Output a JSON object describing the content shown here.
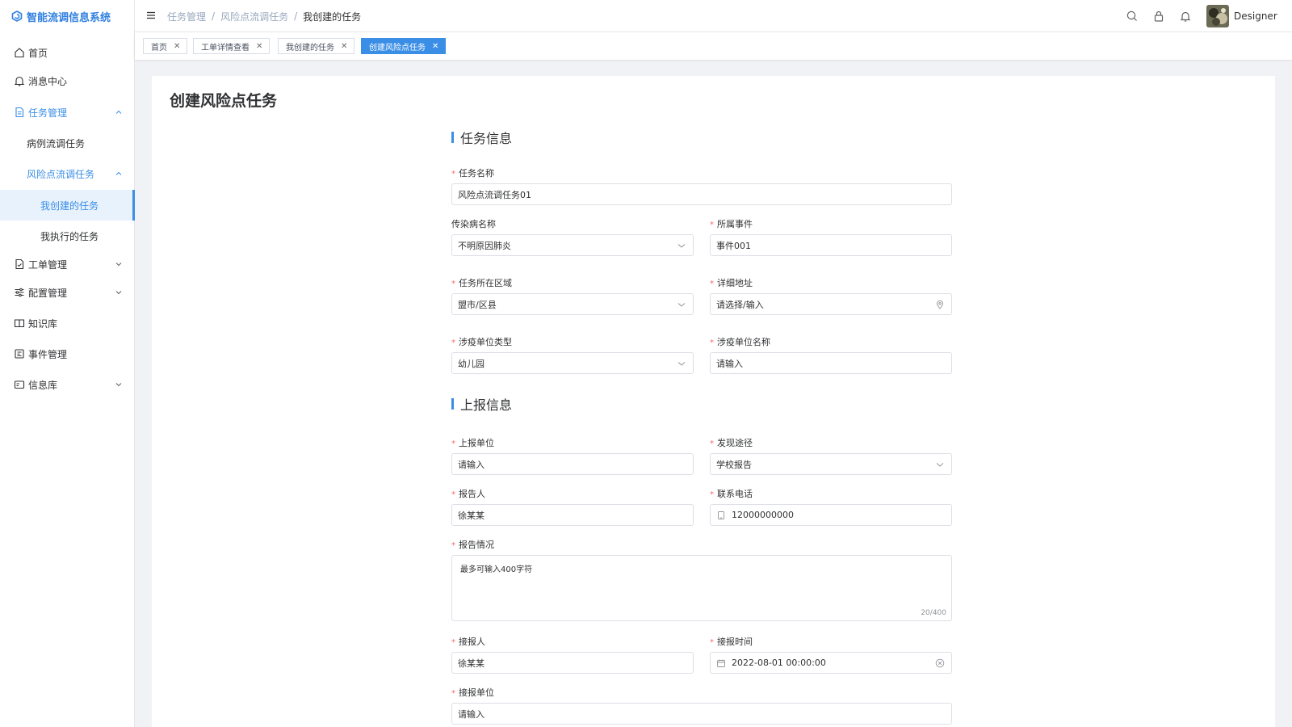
{
  "app": {
    "title": "智能流调信息系统"
  },
  "sidebar": {
    "items": [
      {
        "label": "首页"
      },
      {
        "label": "消息中心"
      },
      {
        "label": "任务管理"
      },
      {
        "label": "病例流调任务"
      },
      {
        "label": "风险点流调任务"
      },
      {
        "label": "我创建的任务"
      },
      {
        "label": "我执行的任务"
      },
      {
        "label": "工单管理"
      },
      {
        "label": "配置管理"
      },
      {
        "label": "知识库"
      },
      {
        "label": "事件管理"
      },
      {
        "label": "信息库"
      }
    ]
  },
  "breadcrumb": {
    "items": [
      "任务管理",
      "风险点流调任务",
      "我创建的任务"
    ]
  },
  "user": {
    "name": "Designer"
  },
  "tags": [
    {
      "label": "首页"
    },
    {
      "label": "工单详情查看"
    },
    {
      "label": "我创建的任务"
    },
    {
      "label": "创建风险点任务"
    }
  ],
  "page": {
    "title": "创建风险点任务"
  },
  "task_section": {
    "title": "任务信息",
    "task_name": {
      "label": "任务名称",
      "value": "风险点流调任务01"
    },
    "disease": {
      "label": "传染病名称",
      "value": "不明原因肺炎"
    },
    "event": {
      "label": "所属事件",
      "value": "事件001"
    },
    "region": {
      "label": "任务所在区域",
      "value": "盟市/区县"
    },
    "address": {
      "label": "详细地址",
      "placeholder": "请选择/输入"
    },
    "unit_type": {
      "label": "涉疫单位类型",
      "value": "幼儿园"
    },
    "unit_name": {
      "label": "涉疫单位名称",
      "placeholder": "请输入"
    }
  },
  "report_section": {
    "title": "上报信息",
    "report_unit": {
      "label": "上报单位",
      "placeholder": "请输入"
    },
    "discovery": {
      "label": "发现途径",
      "value": "学校报告"
    },
    "reporter": {
      "label": "报告人",
      "value": "徐某某"
    },
    "phone": {
      "label": "联系电话",
      "value": "12000000000"
    },
    "situation": {
      "label": "报告情况",
      "placeholder": "最多可输入400字符",
      "count": "20/400"
    },
    "receiver": {
      "label": "接报人",
      "value": "徐某某"
    },
    "receive_time": {
      "label": "接报时间",
      "value": "2022-08-01 00:00:00"
    },
    "receive_unit": {
      "label": "接报单位",
      "placeholder": "请输入"
    }
  },
  "colors": {
    "primary": "#3a8ee6",
    "required": "#f56c6c",
    "active_bg": "#e8f2fd"
  }
}
